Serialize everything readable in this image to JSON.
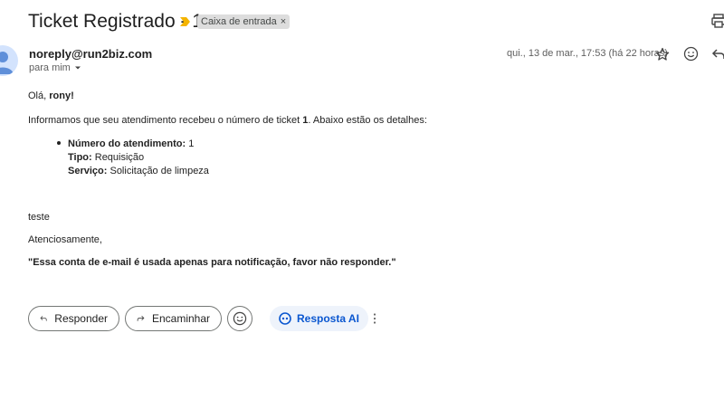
{
  "email": {
    "subject": "Ticket Registrado - 1",
    "label": "Caixa de entrada",
    "label_remove": "×",
    "sender": "noreply@run2biz.com",
    "to": "para mim",
    "date": "qui., 13 de mar., 17:53 (há 22 horas)"
  },
  "body": {
    "greeting_prefix": "Olá, ",
    "greeting_name": "rony!",
    "intro_prefix": "Informamos que seu atendimento recebeu o número de ticket ",
    "intro_ticket": "1",
    "intro_suffix": ". Abaixo estão os detalhes:",
    "details": [
      {
        "label": "Número do atendimento:",
        "value": " 1"
      },
      {
        "label": "Tipo:",
        "value": " Requisição"
      },
      {
        "label": "Serviço:",
        "value": " Solicitação de limpeza"
      }
    ],
    "extra": "teste",
    "closing": "Atenciosamente,",
    "notice": "\"Essa conta de e-mail é usada apenas para notificação, favor não responder.\""
  },
  "actions": {
    "reply": "Responder",
    "forward": "Encaminhar",
    "ai": "Resposta AI"
  },
  "icons": {
    "importance": "importance-marker-icon",
    "print": "print-icon",
    "star": "star-icon",
    "emoji": "emoji-icon",
    "reply": "reply-icon",
    "more": "more-vertical-icon"
  },
  "colors": {
    "importance": "#f4b400",
    "accent": "#0b57d0",
    "avatar": "#5f8fd9"
  }
}
